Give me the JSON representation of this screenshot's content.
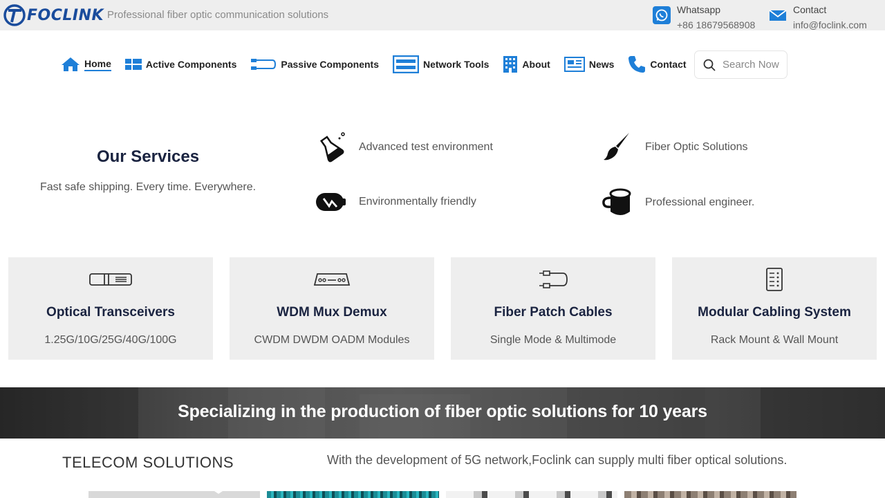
{
  "brand": {
    "logo_text": "FOCLINK",
    "tagline": "Professional fiber optic communication solutions"
  },
  "contacts": [
    {
      "icon": "whatsapp-icon",
      "label": "Whatsapp",
      "value": "+86 18679568908",
      "color": "#1e7fd8"
    },
    {
      "icon": "mail-icon",
      "label": "Contact",
      "value": "info@foclink.com",
      "color": "#1e7fd8"
    }
  ],
  "nav": {
    "items": [
      {
        "label": "Home",
        "icon": "home-icon",
        "active": true
      },
      {
        "label": "Active Components",
        "icon": "grid-icon"
      },
      {
        "label": "Passive Components",
        "icon": "patch-cable-icon"
      },
      {
        "label": "Network Tools",
        "icon": "rack-icon"
      },
      {
        "label": "About",
        "icon": "building-icon"
      },
      {
        "label": "News",
        "icon": "newspaper-icon"
      },
      {
        "label": "Contact",
        "icon": "phone-icon"
      }
    ],
    "search_placeholder": "Search Now"
  },
  "services": {
    "title": "Our Services",
    "subtitle": "Fast safe shipping. Every time. Everywhere.",
    "items": [
      {
        "icon": "flask-icon",
        "label": "Advanced test environment"
      },
      {
        "icon": "brush-icon",
        "label": "Fiber Optic Solutions"
      },
      {
        "icon": "battery-icon",
        "label": "Environmentally friendly"
      },
      {
        "icon": "cup-icon",
        "label": "Professional engineer."
      }
    ]
  },
  "cards": [
    {
      "icon": "transceiver-icon",
      "title": "Optical Transceivers",
      "subtitle": "1.25G/10G/25G/40G/100G"
    },
    {
      "icon": "mux-icon",
      "title": "WDM Mux Demux",
      "subtitle": "CWDM DWDM OADM Modules"
    },
    {
      "icon": "patch-cable-icon",
      "title": "Fiber Patch Cables",
      "subtitle": "Single Mode & Multimode"
    },
    {
      "icon": "cabinet-icon",
      "title": "Modular Cabling System",
      "subtitle": "Rack Mount & Wall Mount"
    }
  ],
  "banner": {
    "text": "Specializing in the production of fiber optic solutions for 10 years"
  },
  "telecom": {
    "title": "TELECOM SOLUTIONS",
    "description": "With the development of 5G network,Foclink can supply multi fiber optical solutions."
  },
  "colors": {
    "accent": "#1e7fd8",
    "brand": "#1a4c9c",
    "heading": "#1a2340",
    "card_bg": "#eeeeee",
    "topbar_bg": "#eeeeee"
  }
}
